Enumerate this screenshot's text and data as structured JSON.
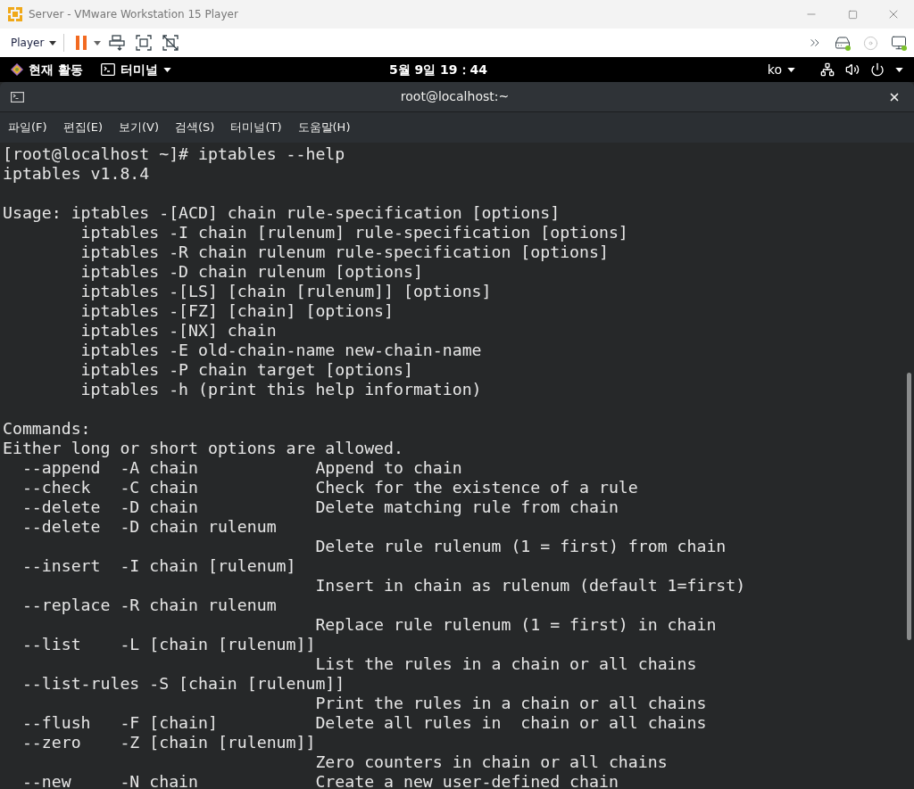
{
  "window": {
    "title": "Server - VMware Workstation 15 Player"
  },
  "toolbar": {
    "player_menu": "Player"
  },
  "top_bar": {
    "activities": "현재 활동",
    "app_menu": "터미널",
    "clock": "5월 9일 19：44",
    "input_method": "ko"
  },
  "terminal": {
    "title": "root@localhost:~",
    "menu": [
      "파일(F)",
      "편집(E)",
      "보기(V)",
      "검색(S)",
      "터미널(T)",
      "도움말(H)"
    ],
    "blocks": [
      [
        "[root@localhost ~]# iptables --help",
        "iptables v1.8.4"
      ],
      [
        "Usage: iptables -[ACD] chain rule-specification [options]",
        "        iptables -I chain [rulenum] rule-specification [options]",
        "        iptables -R chain rulenum rule-specification [options]",
        "        iptables -D chain rulenum [options]",
        "        iptables -[LS] [chain [rulenum]] [options]",
        "        iptables -[FZ] [chain] [options]",
        "        iptables -[NX] chain",
        "        iptables -E old-chain-name new-chain-name",
        "        iptables -P chain target [options]",
        "        iptables -h (print this help information)"
      ],
      [
        "Commands:",
        "Either long or short options are allowed.",
        "  --append  -A chain            Append to chain",
        "  --check   -C chain            Check for the existence of a rule",
        "  --delete  -D chain            Delete matching rule from chain",
        "  --delete  -D chain rulenum",
        "                                Delete rule rulenum (1 = first) from chain",
        "  --insert  -I chain [rulenum]",
        "                                Insert in chain as rulenum (default 1=first)",
        "  --replace -R chain rulenum",
        "                                Replace rule rulenum (1 = first) in chain",
        "  --list    -L [chain [rulenum]]",
        "                                List the rules in a chain or all chains",
        "  --list-rules -S [chain [rulenum]]",
        "                                Print the rules in a chain or all chains",
        "  --flush   -F [chain]          Delete all rules in  chain or all chains",
        "  --zero    -Z [chain [rulenum]]",
        "                                Zero counters in chain or all chains",
        "  --new     -N chain            Create a new user-defined chain"
      ]
    ]
  }
}
